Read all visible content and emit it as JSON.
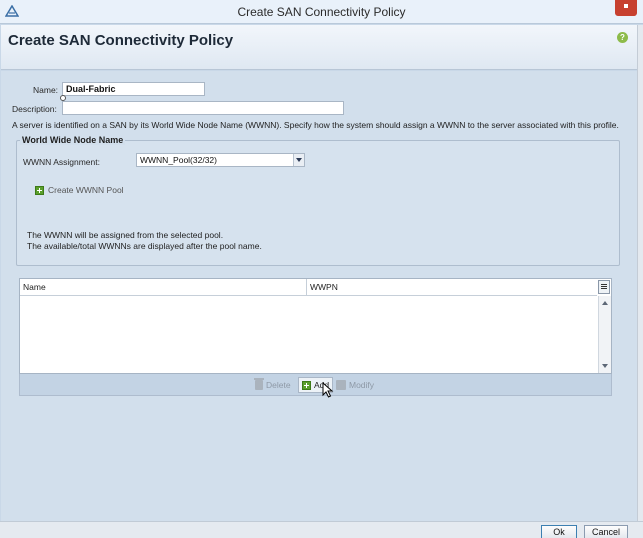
{
  "window": {
    "title": "Create SAN Connectivity Policy"
  },
  "header": {
    "title": "Create SAN Connectivity Policy",
    "help_icon": "help-icon"
  },
  "form": {
    "name_label": "Name:",
    "name_value": "Dual-Fabric",
    "description_label": "Description:",
    "description_value": "",
    "info_text": "A server is identified on a SAN by its World Wide Node Name (WWNN). Specify how the system should assign a WWNN to the server associated with this profile."
  },
  "wwnn_group": {
    "legend": "World Wide Node Name",
    "assignment_label": "WWNN Assignment:",
    "assignment_value": "WWNN_Pool(32/32)",
    "create_pool_label": "Create WWNN Pool",
    "note_line1": "The WWNN will be assigned from the selected pool.",
    "note_line2": "The available/total WWNNs are displayed after the pool name."
  },
  "table": {
    "columns": [
      "Name",
      "WWPN"
    ],
    "rows": []
  },
  "table_toolbar": {
    "delete_label": "Delete",
    "add_label": "Add",
    "modify_label": "Modify"
  },
  "footer": {
    "ok_label": "Ok",
    "cancel_label": "Cancel"
  },
  "colors": {
    "background": "#d2dfec",
    "add_icon": "#5a9f2b",
    "help_icon": "#8dbb4a"
  }
}
